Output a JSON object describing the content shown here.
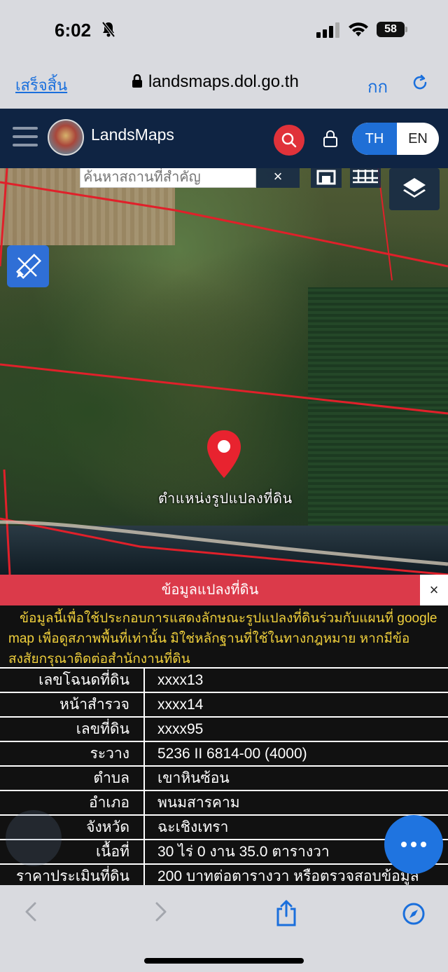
{
  "status_bar": {
    "time": "6:02",
    "battery": "58"
  },
  "browser": {
    "done_label": "เสร็จสิ้น",
    "url": "landsmaps.dol.go.th",
    "text_size_label": "กก"
  },
  "header": {
    "brand": "LandsMaps",
    "lang_th": "TH",
    "lang_en": "EN",
    "accent": "#1f6fd6",
    "bg": "#0f2443"
  },
  "map": {
    "search_placeholder": "ค้นหาสถานที่สำคัญ",
    "clear_label": "×",
    "pin_label": "ตำแหน่งรูปแปลงที่ดิน"
  },
  "panel": {
    "title": "ข้อมูลแปลงที่ดิน",
    "close_label": "×",
    "disclaimer": "ข้อมูลนี้เพื่อใช้ประกอบการแสดงลักษณะรูปแปลงที่ดินร่วมกับแผนที่ google map เพื่อดูสภาพพื้นที่เท่านั้น มิใช่หลักฐานที่ใช้ในทางกฎหมาย หากมีข้อสงสัยกรุณาติดต่อสำนักงานที่ดิน",
    "rows": [
      {
        "label": "เลขโฉนดที่ดิน",
        "value": "xxxx13"
      },
      {
        "label": "หน้าสำรวจ",
        "value": "xxxx14"
      },
      {
        "label": "เลขที่ดิน",
        "value": "xxxx95"
      },
      {
        "label": "ระวาง",
        "value": "5236 II 6814-00 (4000)"
      },
      {
        "label": "ตำบล",
        "value": "เขาหินซ้อน"
      },
      {
        "label": "อำเภอ",
        "value": "พนมสารคาม"
      },
      {
        "label": "จังหวัด",
        "value": "ฉะเชิงเทรา"
      },
      {
        "label": "เนื้อที่",
        "value": "30 ไร่ 0 งาน 35.0 ตารางวา"
      },
      {
        "label": "ราคาประเมินที่ดิน",
        "value": "200 บาทต่อตารางวา หรือตรวจสอบข้อมูล"
      }
    ],
    "title_color": "#db3a4a",
    "disclaimer_color": "#f0d03c"
  }
}
